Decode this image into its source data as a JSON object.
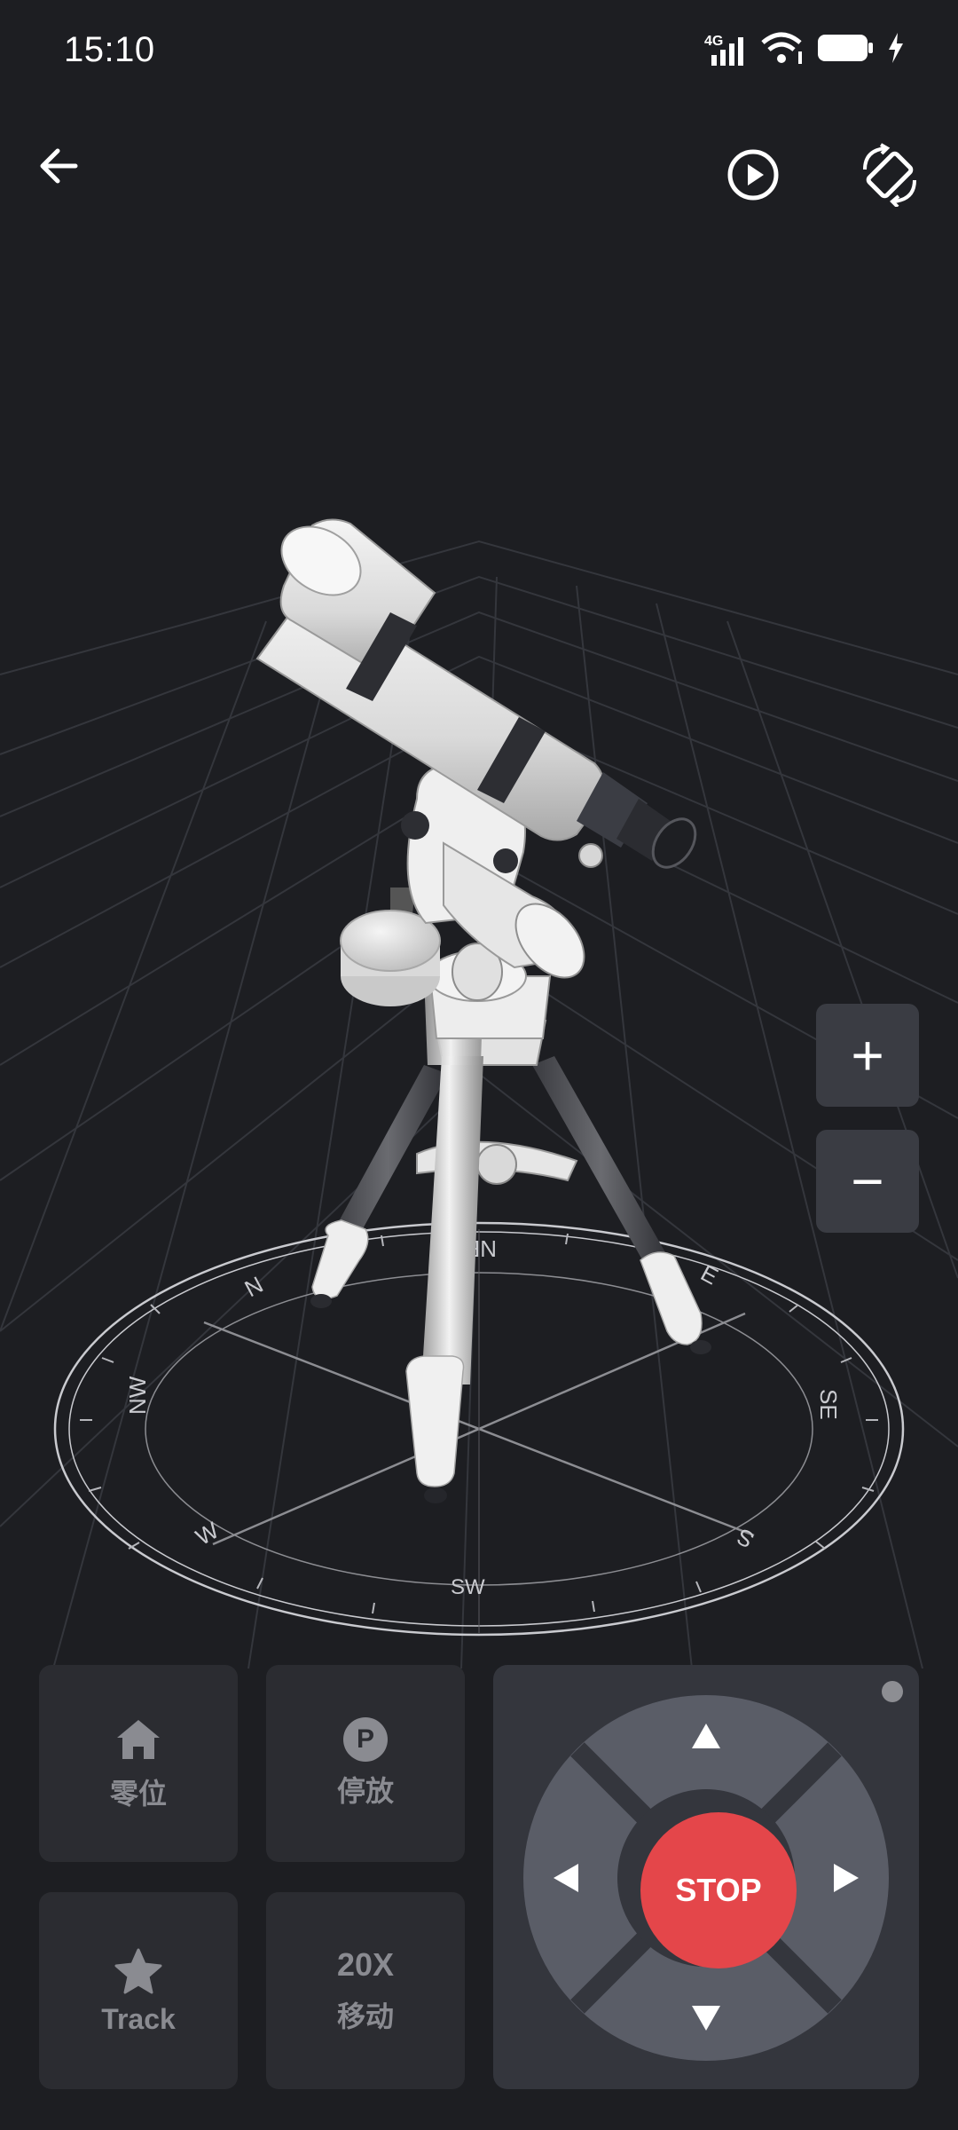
{
  "status_bar": {
    "time": "15:10",
    "network": "4G",
    "icons": [
      "signal-icon",
      "wifi-icon",
      "battery-icon",
      "charging-icon"
    ]
  },
  "toolbar": {
    "icons": [
      "back-arrow-icon",
      "play-icon",
      "screen-rotate-icon"
    ]
  },
  "scene": {
    "compass_labels": [
      "N",
      "NE",
      "E",
      "SE",
      "S",
      "SW",
      "W",
      "NW"
    ]
  },
  "zoom": {
    "in_label": "+",
    "out_label": "−"
  },
  "actions": {
    "home_label": "零位",
    "home_icon": "home-icon",
    "park_label": "停放",
    "park_icon": "parking-icon",
    "park_glyph": "P",
    "track_label": "Track",
    "track_icon": "star-icon",
    "speed_value": "20X",
    "speed_label": "移动"
  },
  "dpad": {
    "stop_label": "STOP",
    "icons": [
      "arrow-up-icon",
      "arrow-down-icon",
      "arrow-left-icon",
      "arrow-right-icon"
    ],
    "accent_color": "#e4464a"
  }
}
